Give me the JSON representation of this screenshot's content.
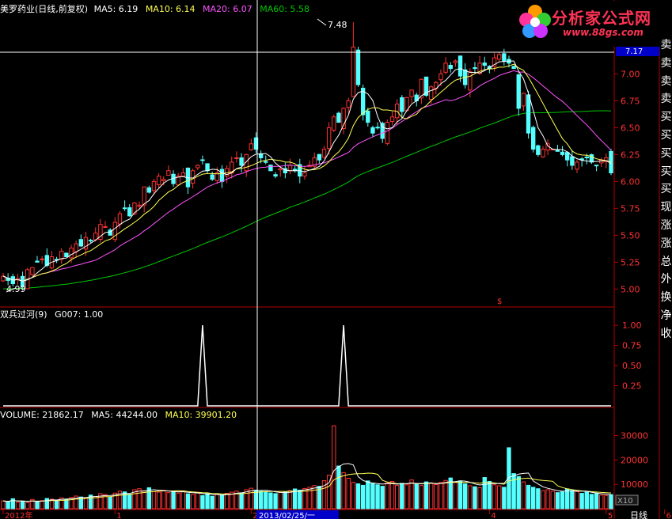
{
  "header": {
    "stock_name": "美罗药业(日线,前复权)",
    "ma5": "MA5: 6.19",
    "ma10": "MA10: 6.14",
    "ma20": "MA20: 6.07",
    "ma60": "MA60: 5.58"
  },
  "indicator_header": {
    "name": "双兵过河(9)",
    "value": "G007: 1.00"
  },
  "volume_header": {
    "volume": "VOLUME: 21862.17",
    "ma5": "MA5: 44244.00",
    "ma10": "MA10: 39901.20"
  },
  "watermark": {
    "title": "分析家公式网",
    "url": "www.88gs.com"
  },
  "side_panel": {
    "labels": [
      "卖",
      "卖",
      "卖",
      "卖",
      "买",
      "买",
      "买",
      "买",
      "买",
      "现",
      "涨",
      "涨",
      "总",
      "外",
      "换",
      "净",
      "收"
    ]
  },
  "annotations": {
    "high_label": "7.48",
    "low_label": "4.99",
    "crosshair_date": "2013/02/25/一",
    "price_box": "7.17",
    "x10": "X10",
    "period": "日线"
  },
  "colors": {
    "up": "#ff3232",
    "down": "#54ffff",
    "ma5": "#ffffff",
    "ma10": "#ffff54",
    "ma20": "#ff54ff",
    "ma60": "#00c800",
    "axis": "#b40000",
    "tick_text": "#ff3232"
  },
  "chart_data": [
    {
      "type": "candlestick",
      "title": "美罗药业(日线,前复权)",
      "y_ticks": [
        "7.00",
        "6.75",
        "6.50",
        "6.25",
        "6.00",
        "5.75",
        "5.50",
        "5.25",
        "5.00"
      ],
      "ylim": [
        4.87,
        7.54
      ],
      "x_tick_labels": [
        "2012年",
        "1",
        "2",
        "2013/02/25/一",
        "4",
        "5",
        "6"
      ],
      "close": [
        5.12,
        5.08,
        5.05,
        5.1,
        5.02,
        5.18,
        5.2,
        5.25,
        5.28,
        5.22,
        5.3,
        5.27,
        5.35,
        5.3,
        5.38,
        5.42,
        5.4,
        5.48,
        5.45,
        5.52,
        5.6,
        5.58,
        5.5,
        5.62,
        5.7,
        5.75,
        5.68,
        5.8,
        5.78,
        5.95,
        5.9,
        6.0,
        6.05,
        6.02,
        6.1,
        5.98,
        6.05,
        6.08,
        5.95,
        6.1,
        6.15,
        6.2,
        6.1,
        6.02,
        6.08,
        6.0,
        6.12,
        6.18,
        6.22,
        6.15,
        6.25,
        6.35,
        6.3,
        6.22,
        6.18,
        6.1,
        6.05,
        6.12,
        6.08,
        6.15,
        6.1,
        6.05,
        6.08,
        6.15,
        6.22,
        6.2,
        6.3,
        6.5,
        6.6,
        6.55,
        6.68,
        6.75,
        7.25,
        6.9,
        6.62,
        6.55,
        6.45,
        6.5,
        6.4,
        6.55,
        6.6,
        6.72,
        6.65,
        6.78,
        6.85,
        6.75,
        6.95,
        6.8,
        6.88,
        6.92,
        7.0,
        7.1,
        7.05,
        7.12,
        6.98,
        6.9,
        7.02,
        7.05,
        7.1,
        7.08,
        7.05,
        7.15,
        7.18,
        7.12,
        7.1,
        7.05,
        6.68,
        6.82,
        6.45,
        6.3,
        6.25,
        6.3,
        6.35,
        6.3,
        6.28,
        6.25,
        6.2,
        6.15,
        6.18,
        6.2,
        6.22,
        6.18,
        6.15,
        6.2,
        6.22,
        6.08
      ],
      "series": [
        {
          "name": "MA5",
          "color": "#ffffff"
        },
        {
          "name": "MA10",
          "color": "#ffff54"
        },
        {
          "name": "MA20",
          "color": "#ff54ff"
        },
        {
          "name": "MA60",
          "color": "#00c800"
        }
      ]
    },
    {
      "type": "line",
      "title": "双兵过河(9)",
      "series_name": "G007",
      "y_ticks": [
        "1.00",
        "0.75",
        "0.50",
        "0.25"
      ],
      "ylim": [
        0,
        1.05
      ],
      "signal_days": [
        41,
        70
      ],
      "values_note": "0 except 1.00 at signal days"
    },
    {
      "type": "bar",
      "title": "VOLUME",
      "y_ticks": [
        "30000",
        "20000",
        "10000"
      ],
      "ylim": [
        0,
        36000
      ],
      "values": [
        3200,
        2800,
        4100,
        2600,
        3000,
        2500,
        3800,
        2900,
        3300,
        4200,
        3900,
        3500,
        4400,
        3800,
        4600,
        5200,
        4800,
        4300,
        5600,
        5000,
        6200,
        5800,
        4700,
        6400,
        7200,
        6900,
        5900,
        7800,
        8200,
        7400,
        8600,
        7000,
        6800,
        7500,
        6600,
        7100,
        6400,
        7300,
        6100,
        5800,
        6700,
        5400,
        6200,
        5100,
        5900,
        5600,
        6300,
        6800,
        7200,
        6500,
        7800,
        8400,
        7600,
        7100,
        6900,
        6500,
        6200,
        6700,
        7000,
        7400,
        8100,
        7600,
        8300,
        8800,
        9500,
        9200,
        11500,
        13800,
        34000,
        17500,
        14800,
        12500,
        10800,
        10200,
        9600,
        11400,
        10500,
        9800,
        9200,
        10600,
        11200,
        9600,
        10400,
        9800,
        11800,
        10200,
        9600,
        11000,
        10400,
        9900,
        10800,
        11600,
        12600,
        10800,
        11400,
        10200,
        9400,
        9000,
        8600,
        12800,
        11200,
        9800,
        9400,
        8800,
        25000,
        14400,
        13200,
        11000,
        9600,
        8800,
        8200,
        7400,
        7800,
        7200,
        6600,
        6900,
        8100,
        7500,
        7000,
        6300,
        6800,
        5900,
        6200,
        5600,
        5400,
        5800
      ],
      "series": [
        {
          "name": "MA5",
          "color": "#ffffff"
        },
        {
          "name": "MA10",
          "color": "#ffff54"
        }
      ]
    }
  ]
}
